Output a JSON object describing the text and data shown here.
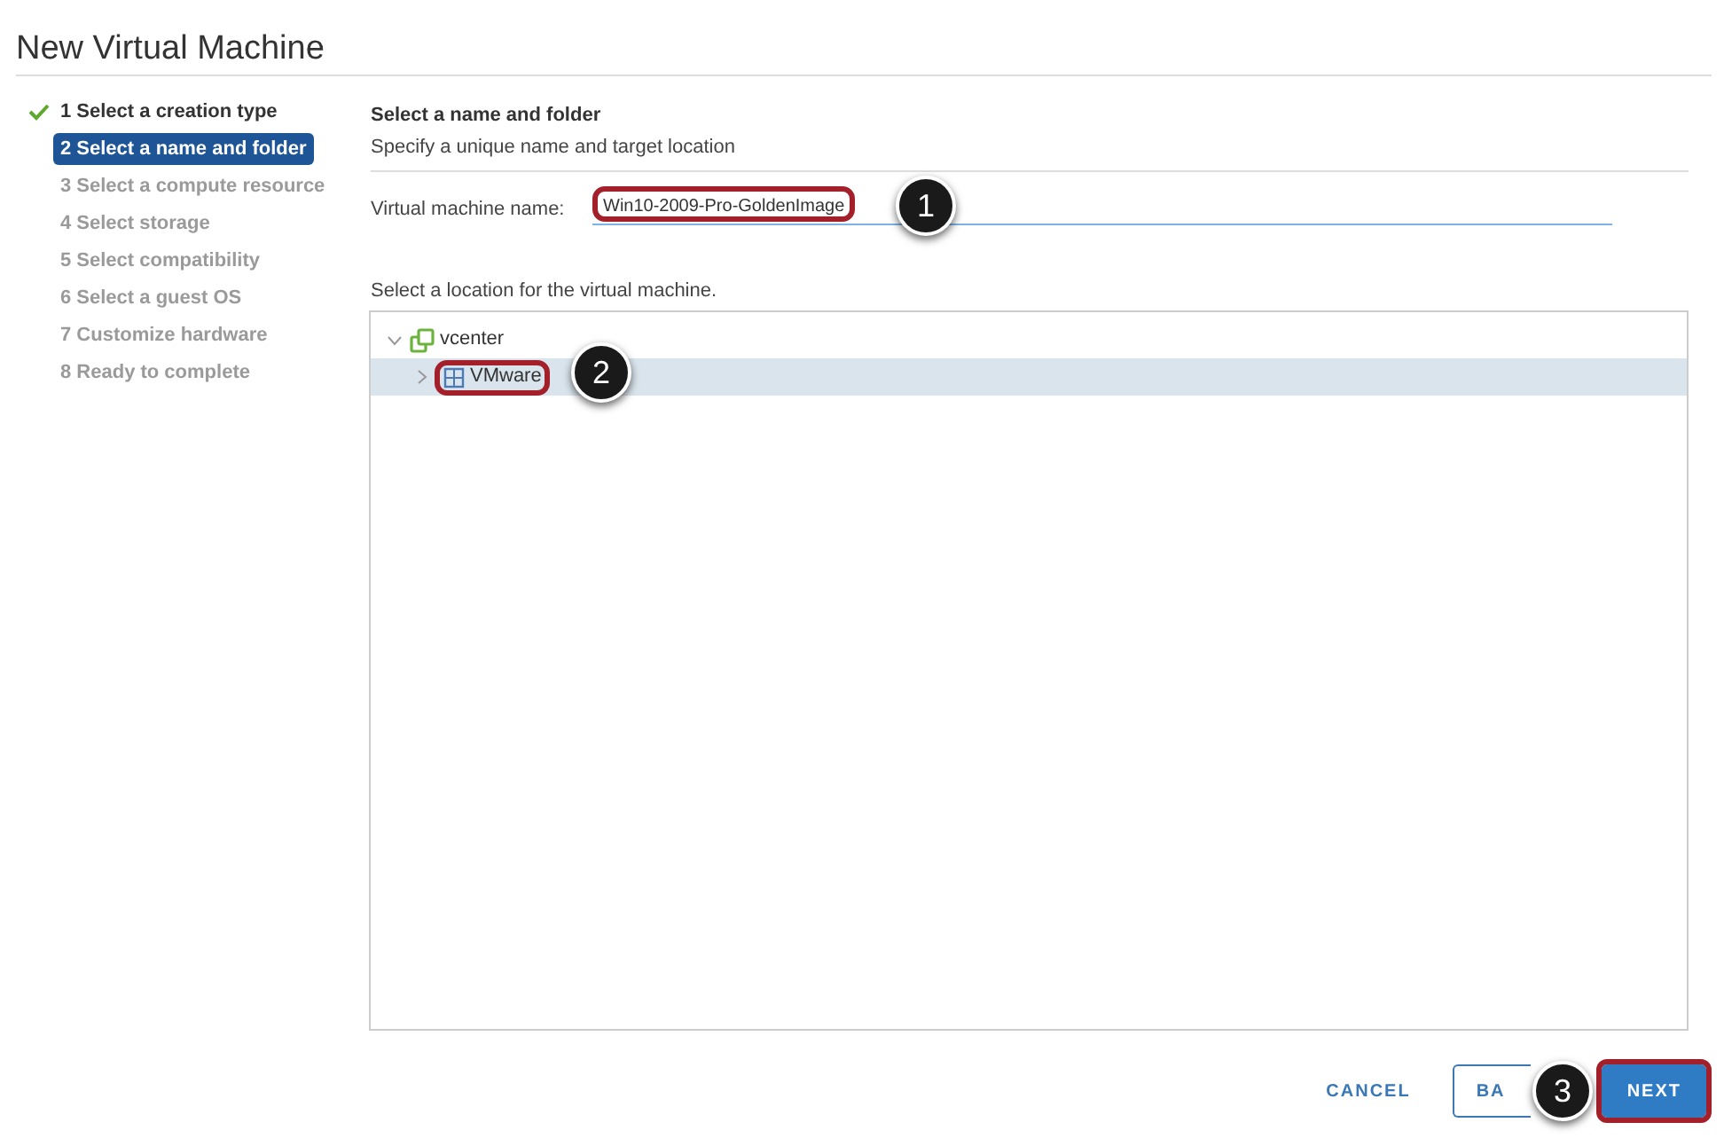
{
  "window": {
    "title": "New Virtual Machine"
  },
  "steps": [
    {
      "label": "1 Select a creation type",
      "completed": true,
      "selected": false
    },
    {
      "label": "2 Select a name and folder",
      "completed": false,
      "selected": true
    },
    {
      "label": "3 Select a compute resource",
      "completed": false,
      "selected": false
    },
    {
      "label": "4 Select storage",
      "completed": false,
      "selected": false
    },
    {
      "label": "5 Select compatibility",
      "completed": false,
      "selected": false
    },
    {
      "label": "6 Select a guest OS",
      "completed": false,
      "selected": false
    },
    {
      "label": "7 Customize hardware",
      "completed": false,
      "selected": false
    },
    {
      "label": "8 Ready to complete",
      "completed": false,
      "selected": false
    }
  ],
  "page": {
    "heading": "Select a name and folder",
    "subheading": "Specify a unique name and target location"
  },
  "name_field": {
    "label": "Virtual machine name:",
    "value": "Win10-2009-Pro-GoldenImage",
    "highlighted": true
  },
  "location": {
    "label": "Select a location for the virtual machine.",
    "tree": [
      {
        "label": "vcenter",
        "kind": "vcenter",
        "expanded": true,
        "selected": false,
        "highlighted": false,
        "children": [
          {
            "label": "VMware",
            "kind": "datacenter",
            "expanded": false,
            "selected": true,
            "highlighted": true
          }
        ]
      }
    ]
  },
  "buttons": [
    {
      "label": "CANCEL",
      "kind": "flat"
    },
    {
      "label": "BA",
      "kind": "outline"
    },
    {
      "label": "NEXT",
      "kind": "primary",
      "highlighted": true
    }
  ],
  "callouts": [
    {
      "label": "1"
    },
    {
      "label": "2"
    },
    {
      "label": "3"
    }
  ]
}
